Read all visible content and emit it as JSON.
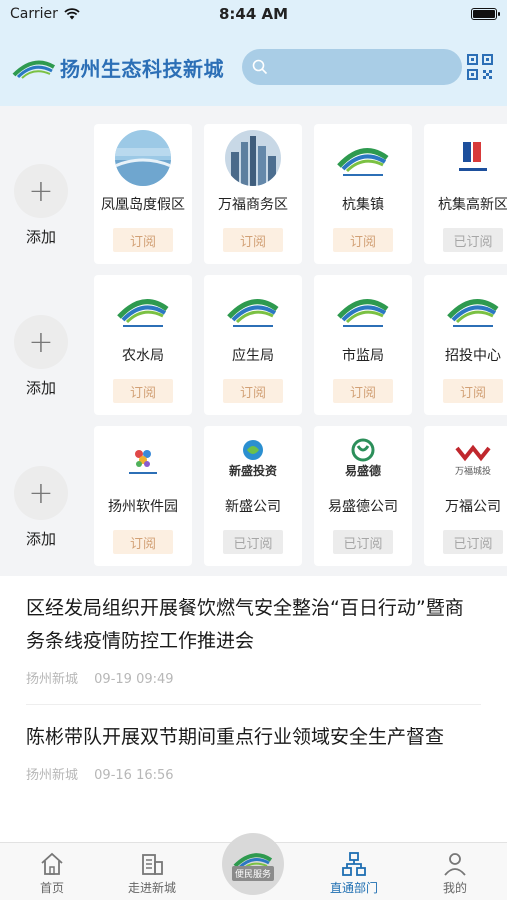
{
  "status_bar": {
    "carrier": "Carrier",
    "time": "8:44 AM"
  },
  "header": {
    "logo_text": "扬州生态科技新城"
  },
  "rows": [
    {
      "add_label": "添加",
      "cards": [
        {
          "name": "凤凰岛度假区",
          "button": "订阅",
          "subscribed": false,
          "icon": "bridge-photo-icon"
        },
        {
          "name": "万福商务区",
          "button": "订阅",
          "subscribed": false,
          "icon": "city-skyline-photo-icon"
        },
        {
          "name": "杭集镇",
          "button": "订阅",
          "subscribed": false,
          "icon": "eco-city-logo-icon"
        },
        {
          "name": "杭集高新区",
          "button": "已订阅",
          "subscribed": true,
          "icon": "hangji-hitech-logo-icon"
        }
      ]
    },
    {
      "add_label": "添加",
      "cards": [
        {
          "name": "农水局",
          "button": "订阅",
          "subscribed": false,
          "icon": "eco-city-logo-icon"
        },
        {
          "name": "应生局",
          "button": "订阅",
          "subscribed": false,
          "icon": "eco-city-logo-icon"
        },
        {
          "name": "市监局",
          "button": "订阅",
          "subscribed": false,
          "icon": "eco-city-logo-icon"
        },
        {
          "name": "招投中心",
          "button": "订阅",
          "subscribed": false,
          "icon": "eco-city-logo-icon"
        }
      ]
    },
    {
      "add_label": "添加",
      "cards": [
        {
          "name": "扬州软件园",
          "button": "订阅",
          "subscribed": false,
          "icon": "software-park-logo-icon"
        },
        {
          "name": "新盛公司",
          "button": "已订阅",
          "subscribed": true,
          "icon": "xinsheng-logo-icon"
        },
        {
          "name": "易盛德公司",
          "button": "已订阅",
          "subscribed": true,
          "icon": "yishengde-logo-icon"
        },
        {
          "name": "万福公司",
          "button": "已订阅",
          "subscribed": true,
          "icon": "wanfu-logo-icon"
        }
      ]
    }
  ],
  "logo_texts": {
    "xinsheng": "新盛投资",
    "yishengde": "易盛德",
    "wanfu": "万福城投"
  },
  "news": [
    {
      "title": "区经发局组织开展餐饮燃气安全整治“百日行动”暨商务条线疫情防控工作推进会",
      "source": "扬州新城",
      "date": "09-19 09:49"
    },
    {
      "title": "陈彬带队开展双节期间重点行业领域安全生产督查",
      "source": "扬州新城",
      "date": "09-16 16:56"
    }
  ],
  "tabs": [
    {
      "label": "首页",
      "icon": "home-icon",
      "active": false
    },
    {
      "label": "走进新城",
      "icon": "building-icon",
      "active": false
    },
    {
      "label": "便民服务",
      "icon": "service-logo-icon",
      "active": false
    },
    {
      "label": "直通部门",
      "icon": "org-chart-icon",
      "active": true
    },
    {
      "label": "我的",
      "icon": "user-icon",
      "active": false
    }
  ],
  "colors": {
    "header_bg": "#dff0fa",
    "brand_blue": "#2c6fb6",
    "active_tab": "#1f6fb2",
    "subscribe_text": "#d2a176",
    "subscribed_text": "#a6a6a6"
  }
}
